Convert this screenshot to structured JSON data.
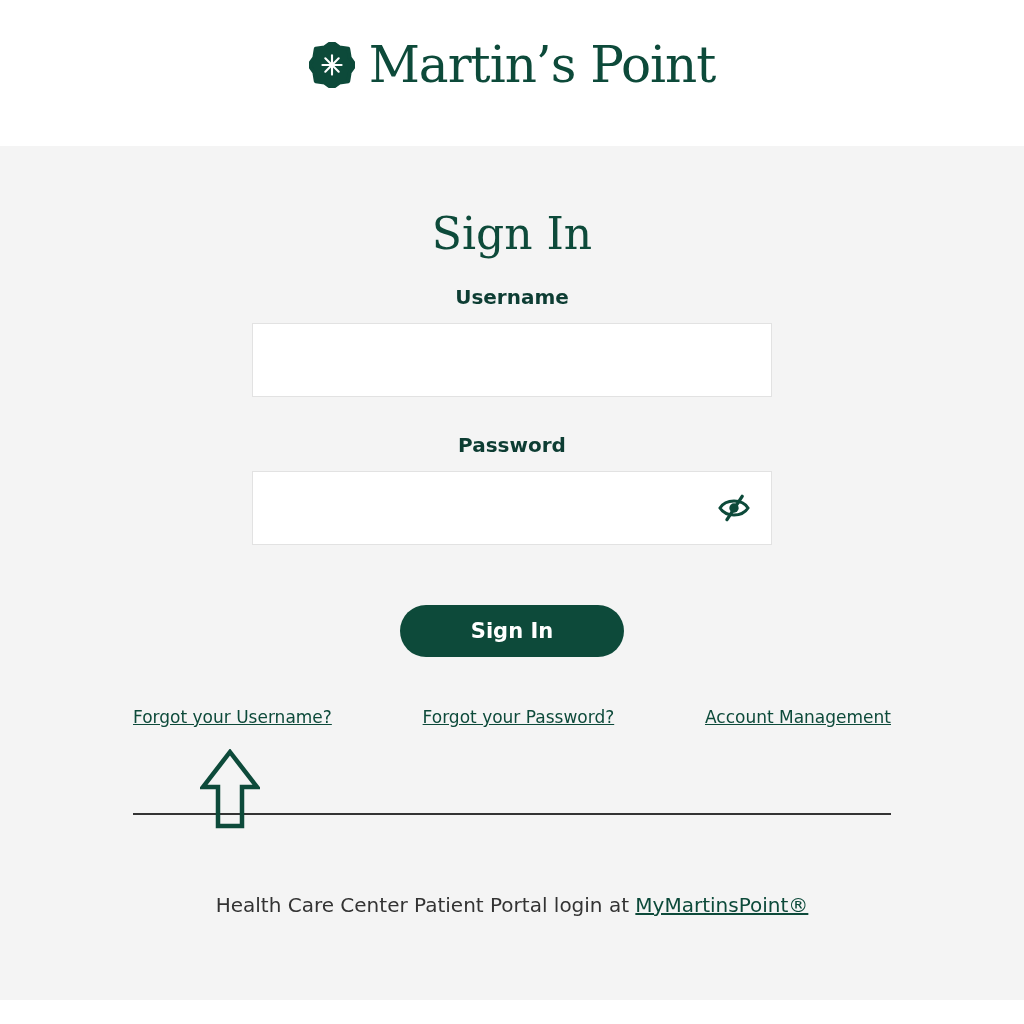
{
  "logo": {
    "text": "Martin’s Point"
  },
  "form": {
    "title": "Sign In",
    "fields": [
      {
        "label": "Username",
        "kind": "text"
      },
      {
        "label": "Password",
        "kind": "password",
        "password_visible": false
      }
    ],
    "submit": "Sign In"
  },
  "links": [
    "Forgot your Username?",
    "Forgot your Password?",
    "Account Management"
  ],
  "footer": {
    "text": "Health Care Center Patient Portal login at ",
    "link": "MyMartinsPoint®"
  }
}
